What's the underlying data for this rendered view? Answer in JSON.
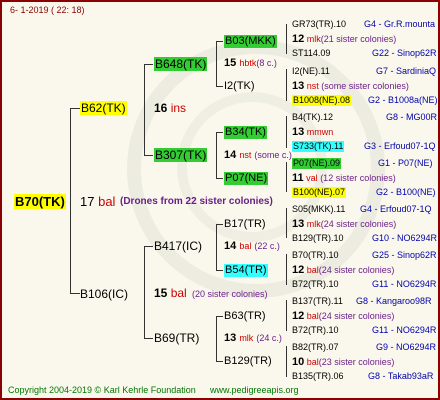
{
  "header_date": "6-  1-2019 ( 22: 18)",
  "root": {
    "id": "B70(TK)",
    "gen": "17",
    "gen_word": "bal",
    "note": "(Drones from 22 sister colonies)"
  },
  "l1": [
    {
      "id": "B62(TK)",
      "gen": "16",
      "gen_word": "ins"
    },
    {
      "id": "B106(IC)",
      "gen": "15",
      "gen_word": "bal",
      "note": "(20 sister colonies)"
    }
  ],
  "l2": [
    {
      "id": "B648(TK)",
      "gen": "15",
      "gen_word": "hbtk",
      "note": "(8 c.)"
    },
    {
      "id": "B307(TK)",
      "gen": "14",
      "gen_word": "nst",
      "note": "(some c.)"
    },
    {
      "id": "B417(IC)",
      "gen": "14",
      "gen_word": "bal",
      "note": "(22 c.)"
    },
    {
      "id": "B69(TR)",
      "gen": "13",
      "gen_word": "mlk",
      "note": "(24 c.)"
    }
  ],
  "l3": [
    {
      "id": "B03(MKK)"
    },
    {
      "id": "I2(TK)"
    },
    {
      "id": "B34(TK)"
    },
    {
      "id": "P07(NE)"
    },
    {
      "id": "B17(TR)"
    },
    {
      "id": "B54(TR)"
    },
    {
      "id": "B63(TR)"
    },
    {
      "id": "B129(TR)"
    }
  ],
  "l4": [
    {
      "top": "GR73(TR).10",
      "gen": "12",
      "gw": "mlk",
      "note": "(21 sister colonies)",
      "bot": "ST114.09",
      "rtop": "G4 - Gr.R.mounta",
      "rbot": "G22 - Sinop62R"
    },
    {
      "top": "I2(NE).11",
      "gen": "13",
      "gw": "nst",
      "note": "(some sister colonies)",
      "bot": "B1008(NE).08",
      "rtop": "G7 - SardiniaQ",
      "rbot": "G2 - B1008a(NE)"
    },
    {
      "top": "B4(TK).12",
      "gen": "13",
      "gw": "mmwn",
      "note": "",
      "bot": "S733(TK).11",
      "rtop": "G8 - MG00R",
      "rbot": "G3 - Erfoud07-1Q"
    },
    {
      "top": "P07(NE).09",
      "gen": "11",
      "gw": "val",
      "note": "(12 sister colonies)",
      "bot": "B100(NE).07",
      "rtop": "G1 - P07(NE)",
      "rbot": "G2 - B100(NE)"
    },
    {
      "top": "S05(MKK).11",
      "gen": "13",
      "gw": "mlk",
      "note": "(24 sister colonies)",
      "bot": "B129(TR).10",
      "rtop": "G4 - Erfoud07-1Q",
      "rbot": "G10 - NO6294R"
    },
    {
      "top": "B70(TR).10",
      "gen": "12",
      "gw": "bal",
      "note": "(24 sister colonies)",
      "bot": "B72(TR).10",
      "rtop": "G25 - Sinop62R",
      "rbot": "G11 - NO6294R"
    },
    {
      "top": "B137(TR).11",
      "gen": "12",
      "gw": "bal",
      "note": "(24 sister colonies)",
      "bot": "B72(TR).10",
      "rtop": "G8 - Kangaroo98R",
      "rbot": "G11 - NO6294R"
    },
    {
      "top": "B82(TR).07",
      "gen": "10",
      "gw": "bal",
      "note": "(23 sister colonies)",
      "bot": "B135(TR).06",
      "rtop": "G9 - NO6294R",
      "rbot": "G8 - Takab93aR"
    }
  ],
  "footer": {
    "copyright": "Copyright 2004-2019 © Karl Kehrle Foundation",
    "url": "www.pedigreeapis.org"
  }
}
